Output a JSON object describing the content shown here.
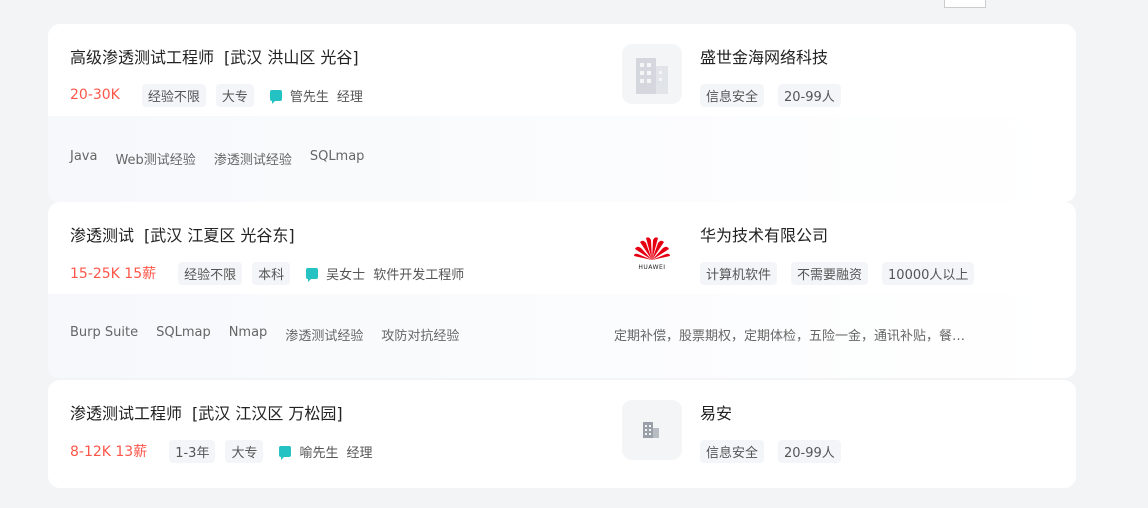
{
  "jobs": [
    {
      "title": "高级渗透测试工程师",
      "location": "[武汉 洪山区 光谷]",
      "salary": "20-30K",
      "experience": "经验不限",
      "education": "大专",
      "recruiter_name": "管先生",
      "recruiter_role": "经理",
      "skills": [
        "Java",
        "Web测试经验",
        "渗透测试经验",
        "SQLmap"
      ],
      "welfare": "",
      "company": {
        "name": "盛世金海网络科技",
        "logo_icon": "building-icon",
        "tags": [
          "信息安全",
          "20-99人"
        ]
      }
    },
    {
      "title": "渗透测试",
      "location": "[武汉 江夏区 光谷东]",
      "salary": "15-25K 15薪",
      "experience": "经验不限",
      "education": "本科",
      "recruiter_name": "吴女士",
      "recruiter_role": "软件开发工程师",
      "skills": [
        "Burp Suite",
        "SQLmap",
        "Nmap",
        "渗透测试经验",
        "攻防对抗经验"
      ],
      "welfare": "定期补偿，股票期权，定期体检，五险一金，通讯补贴，餐…",
      "company": {
        "name": "华为技术有限公司",
        "logo_icon": "huawei-logo-icon",
        "logo_text": "HUAWEI",
        "tags": [
          "计算机软件",
          "不需要融资",
          "10000人以上"
        ]
      }
    },
    {
      "title": "渗透测试工程师",
      "location": "[武汉 江汉区 万松园]",
      "salary": "8-12K 13薪",
      "experience": "1-3年",
      "education": "大专",
      "recruiter_name": "喻先生",
      "recruiter_role": "经理",
      "company": {
        "name": "易安",
        "logo_icon": "building-small-icon",
        "tags": [
          "信息安全",
          "20-99人"
        ]
      }
    }
  ],
  "colors": {
    "salary": "#fe574a",
    "chat_icon": "#25c2c4",
    "tag_bg": "#f3f5f8",
    "huawei_red": "#e60012"
  }
}
